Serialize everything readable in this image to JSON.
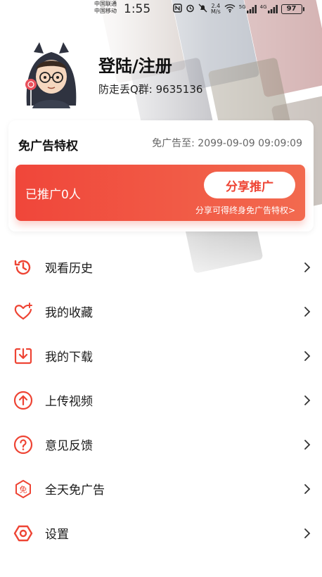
{
  "status_bar": {
    "carrier_1": "中国联通",
    "carrier_2": "中国移动",
    "time": "1:55",
    "net_speed_value": "2.4",
    "net_speed_unit": "M/s",
    "signal_1_label": "5G",
    "signal_2_label": "4G",
    "battery": "97"
  },
  "profile": {
    "login_label": "登陆/注册",
    "qq_group": "防走丢Q群: 9635136"
  },
  "vip_card": {
    "title": "免广告特权",
    "expire_text": "免广告至: 2099-09-09 09:09:09",
    "promo_count": "已推广0人",
    "share_button": "分享推广",
    "share_hint": "分享可得终身免广告特权>"
  },
  "menu": {
    "items": [
      {
        "label": "观看历史",
        "icon": "history-icon"
      },
      {
        "label": "我的收藏",
        "icon": "favorite-heart-icon"
      },
      {
        "label": "我的下载",
        "icon": "download-icon"
      },
      {
        "label": "上传视频",
        "icon": "upload-icon"
      },
      {
        "label": "意见反馈",
        "icon": "feedback-question-icon"
      },
      {
        "label": "全天免广告",
        "icon": "ad-free-icon"
      },
      {
        "label": "设置",
        "icon": "settings-icon"
      }
    ]
  },
  "colors": {
    "accent": "#ee4434",
    "banner_start": "#f0463a",
    "banner_end": "#f26a4f"
  }
}
